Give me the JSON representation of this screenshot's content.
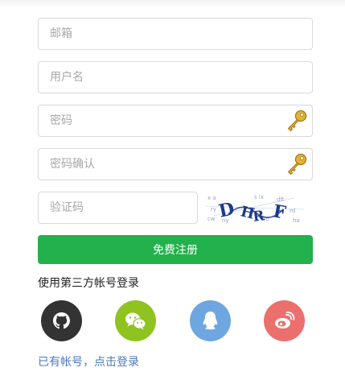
{
  "form": {
    "email": {
      "placeholder": "邮箱",
      "value": ""
    },
    "username": {
      "placeholder": "用户名",
      "value": ""
    },
    "password": {
      "placeholder": "密码",
      "value": ""
    },
    "password_confirm": {
      "placeholder": "密码确认",
      "value": ""
    },
    "captcha": {
      "placeholder": "验证码",
      "value": ""
    },
    "captcha_image_text": "DHRF",
    "submit_label": "免费注册"
  },
  "third_party": {
    "title": "使用第三方帐号登录",
    "providers": [
      {
        "name": "github-icon",
        "color": "#333333"
      },
      {
        "name": "wechat-icon",
        "color": "#8fc31f"
      },
      {
        "name": "qq-icon",
        "color": "#6ea6e0"
      },
      {
        "name": "weibo-icon",
        "color": "#eb6f6c"
      }
    ]
  },
  "footer": {
    "login_link": "已有帐号，点击登录"
  },
  "icons": {
    "password_toggle": "key-icon"
  },
  "colors": {
    "primary_button": "#22b14c",
    "link": "#4a7ab8",
    "border": "#d9d9d9",
    "placeholder": "#a8a8a8"
  }
}
